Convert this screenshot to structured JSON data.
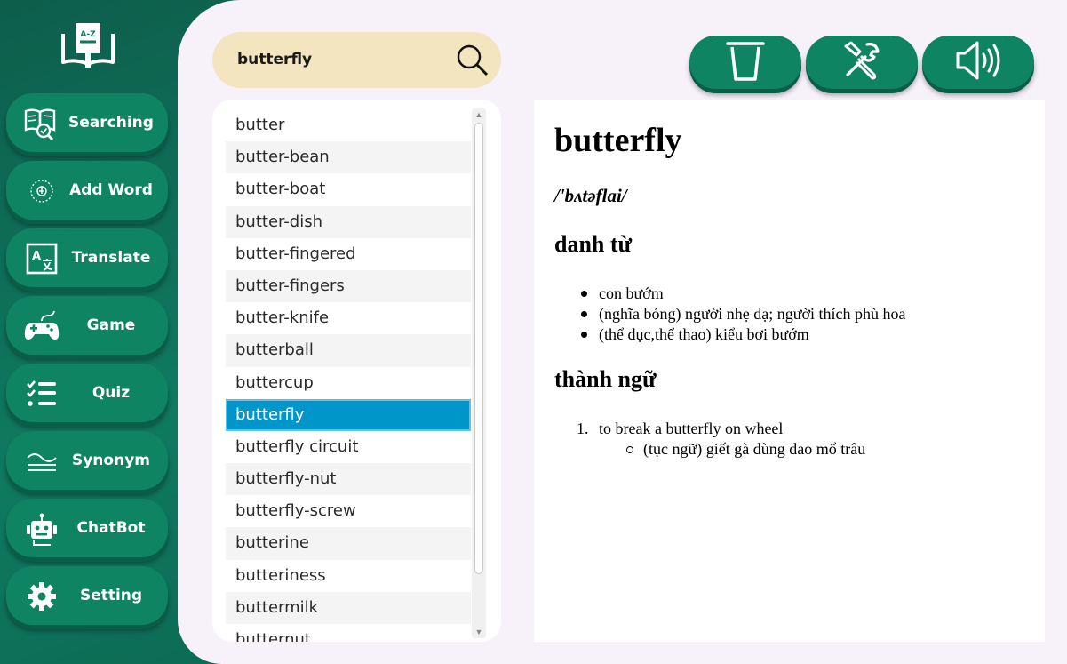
{
  "app": {
    "logo_text": "A-Z"
  },
  "sidebar": {
    "items": [
      {
        "label": "Searching",
        "icon": "book-search-icon"
      },
      {
        "label": "Add Word",
        "icon": "add-circle-icon"
      },
      {
        "label": "Translate",
        "icon": "translate-icon"
      },
      {
        "label": "Game",
        "icon": "gamepad-icon"
      },
      {
        "label": "Quiz",
        "icon": "checklist-icon"
      },
      {
        "label": "Synonym",
        "icon": "waves-icon"
      },
      {
        "label": "ChatBot",
        "icon": "robot-icon"
      },
      {
        "label": "Setting",
        "icon": "gear-icon"
      }
    ]
  },
  "search": {
    "value": "butterfly",
    "icon": "search-icon"
  },
  "word_list": {
    "items": [
      "butter",
      "butter-bean",
      "butter-boat",
      "butter-dish",
      "butter-fingered",
      "butter-fingers",
      "butter-knife",
      "butterball",
      "buttercup",
      "butterfly",
      "butterfly circuit",
      "butterfly-nut",
      "butterfly-screw",
      "butterine",
      "butteriness",
      "buttermilk",
      "butternut"
    ],
    "selected": "butterfly"
  },
  "actions": [
    {
      "name": "delete-button",
      "icon": "trash-icon"
    },
    {
      "name": "edit-button",
      "icon": "tools-icon"
    },
    {
      "name": "speak-button",
      "icon": "speaker-icon"
    }
  ],
  "definition": {
    "word": "butterfly",
    "pronunciation": "/'bʌtəflai/",
    "part_of_speech": "danh từ",
    "meanings": [
      "con bướm",
      "(nghĩa bóng) người nhẹ dạ; người thích phù hoa",
      "(thể dục,thể thao) kiểu bơi bướm"
    ],
    "idiom_title": "thành ngữ",
    "idioms": [
      {
        "number": "1.",
        "text": "to break a butterfly on wheel",
        "meaning": "(tục ngữ) giết gà dùng dao mổ trâu"
      }
    ]
  },
  "colors": {
    "sidebar_bg": "#0f7a5f",
    "button": "#0e8463",
    "main_bg": "#f7f1fa",
    "search_bg": "#f3e5bf",
    "selected": "#0096c9"
  }
}
